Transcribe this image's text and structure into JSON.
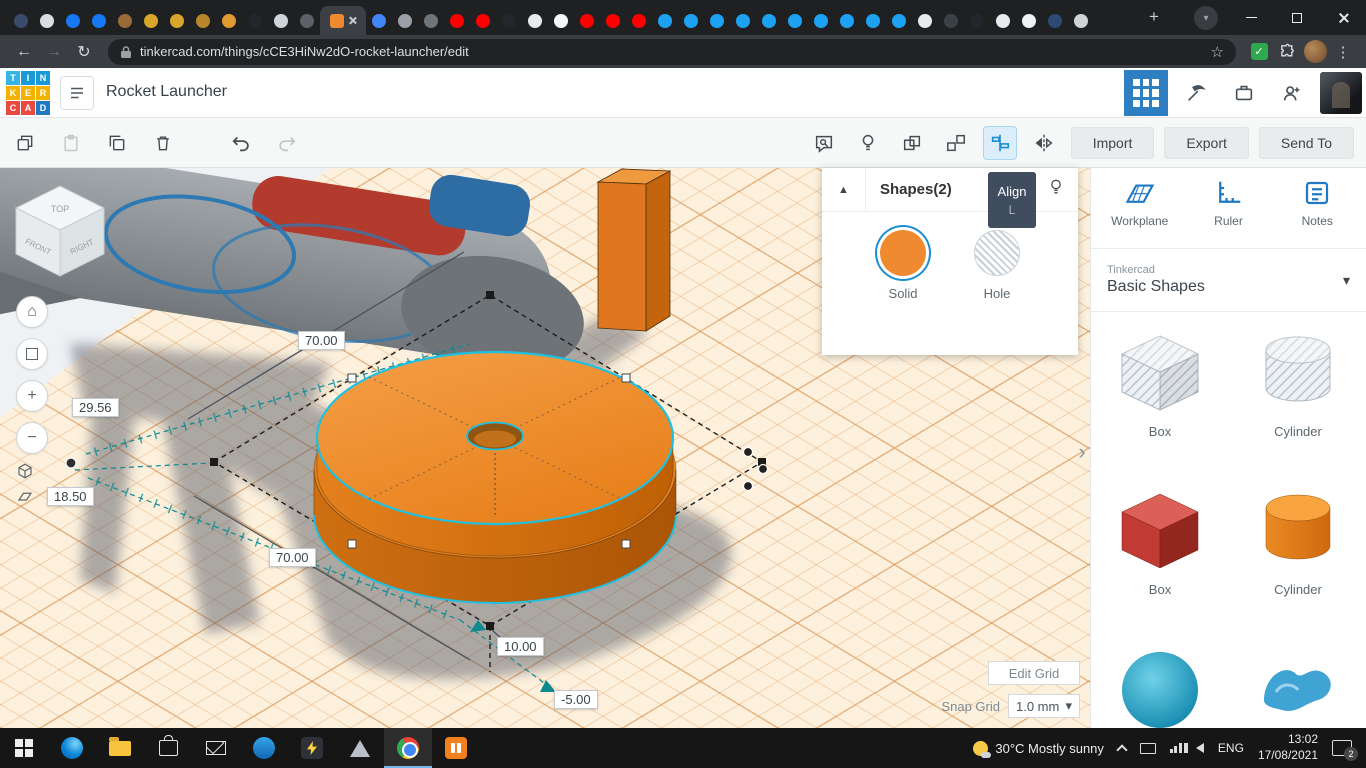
{
  "icons": {
    "plus": "+",
    "minus": "−",
    "home": "⌂",
    "back": "←",
    "forward": "→",
    "reload": "↻",
    "kebab": "⋮",
    "star": "☆",
    "caret_down": "▾",
    "collapse_up": "▲",
    "panel_expand": "›",
    "check": "✓"
  },
  "browser": {
    "active_tab_index": 12,
    "tabs": [
      "#3a4a6b",
      "#d9dde1",
      "#1877f2",
      "#1877f2",
      "#9a6b35",
      "#d8a62a",
      "#d8a62a",
      "#b8862a",
      "#e09a30",
      "#23272b",
      "#cfd4d8",
      "#5b6166",
      "#f08a30",
      "#4285f4",
      "#9aa0a6",
      "#70757a",
      "#ff0000",
      "#ff0000",
      "#23272b",
      "#e8eaed",
      "#f5f6f7",
      "#ff0000",
      "#ff0000",
      "#ff0000",
      "#1da1f2",
      "#1da1f2",
      "#1da1f2",
      "#1da1f2",
      "#1da1f2",
      "#1da1f2",
      "#1da1f2",
      "#1da1f2",
      "#1da1f2",
      "#1da1f2",
      "#e8eaed",
      "#3c4146",
      "#23272b",
      "#e8eaed",
      "#f0f1f2",
      "#2c4a73",
      "#d0d3d6"
    ],
    "url": "tinkercad.com/things/cCE3HiNw2dO-rocket-launcher/edit"
  },
  "header": {
    "title": "Rocket Launcher",
    "logo_cells": [
      {
        "ch": "T",
        "color": "#35b5e5"
      },
      {
        "ch": "I",
        "color": "#189ad7"
      },
      {
        "ch": "N",
        "color": "#189ad7"
      },
      {
        "ch": "K",
        "color": "#f2b200"
      },
      {
        "ch": "E",
        "color": "#f2b200"
      },
      {
        "ch": "R",
        "color": "#f2b200"
      },
      {
        "ch": "C",
        "color": "#e84a3f"
      },
      {
        "ch": "A",
        "color": "#e84a3f"
      },
      {
        "ch": "D",
        "color": "#2079c3"
      }
    ]
  },
  "toolbar": {
    "import": "Import",
    "export": "Export",
    "send_to": "Send To"
  },
  "shapes_panel": {
    "title": "Shapes(2)",
    "solid_label": "Solid",
    "hole_label": "Hole"
  },
  "tooltip": {
    "label": "Align",
    "shortcut": "L"
  },
  "sidebar": {
    "tools": [
      "Workplane",
      "Ruler",
      "Notes"
    ],
    "library_brand": "Tinkercad",
    "library_name": "Basic Shapes",
    "gallery": [
      "Box",
      "Cylinder",
      "Box",
      "Cylinder"
    ]
  },
  "canvas": {
    "viewcube": {
      "top": "TOP",
      "front": "FRONT",
      "right": "RIGHT"
    },
    "dimensions": {
      "top_edge": "70.00",
      "left_a": "29.56",
      "left_b": "18.50",
      "bottom_edge": "70.00",
      "gap": "10.00",
      "height": "-5.00"
    },
    "edit_grid": "Edit Grid",
    "snap_label": "Snap Grid",
    "snap_value": "1.0 mm"
  },
  "taskbar": {
    "weather": "30°C Mostly sunny",
    "language": "ENG",
    "time": "13:02",
    "date": "17/08/2021",
    "notification_count": "2"
  },
  "colors": {
    "accent_blue": "#1d8fd1",
    "selection_cyan": "#1ec1e2",
    "shape_orange": "#f08a30",
    "workplane": "#fdf1dd"
  }
}
